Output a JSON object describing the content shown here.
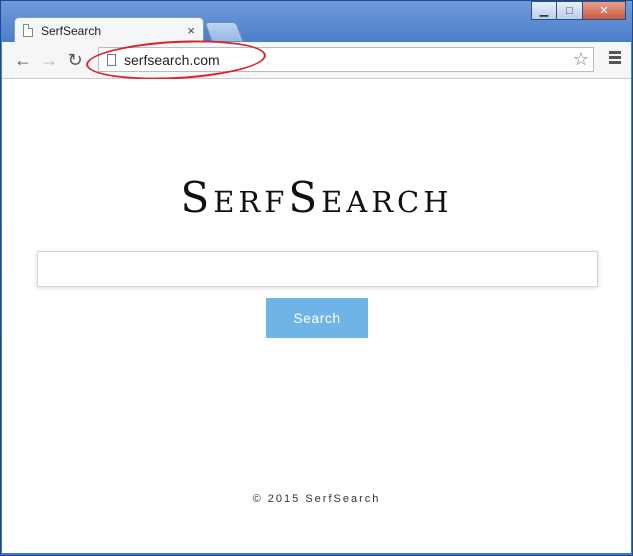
{
  "browser": {
    "tab_title": "SerfSearch",
    "tab_close": "×",
    "url": "serfsearch.com",
    "back": "←",
    "forward": "→",
    "reload": "↻",
    "star": "☆",
    "window_minimize": "▁",
    "window_maximize": "□",
    "window_close": "✕"
  },
  "page": {
    "logo": "SerfSearch",
    "search_placeholder": "",
    "search_button": "Search",
    "footer": "© 2015 SerfSearch"
  },
  "colors": {
    "accent": "#6fb4e6",
    "highlight": "#d7262d"
  }
}
